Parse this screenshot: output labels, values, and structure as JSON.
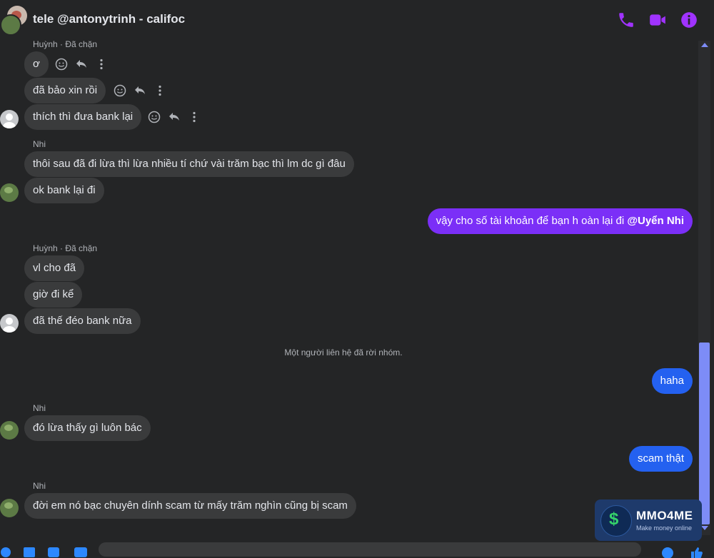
{
  "header": {
    "title": "tele @antonytrinh - califoc",
    "icons": [
      "phone-icon",
      "video-icon",
      "info-icon"
    ],
    "accent": "#a033ff"
  },
  "messages": {
    "s1": "Huỳnh · Đã chặn",
    "m1": "ơ",
    "m2": "đã bảo xin rồi",
    "m3": "thích thì đưa bank lại",
    "s2": "Nhi",
    "m4": "thôi sau đã đi lừa thì lừa nhiều tí chứ vài trăm bạc thì lm dc gì đâu",
    "m5": "ok bank lại đi",
    "m6_text": "vậy cho số tài khoản để bạn h oàn lại đi ",
    "m6_mention": "@Uyển Nhi",
    "s3": "Huỳnh · Đã chặn",
    "m7": "vl cho đã",
    "m8": "giờ đi kể",
    "m9": "đã thế đéo bank nữa",
    "system": "Một người liên hệ đã rời nhóm.",
    "m10": "haha",
    "s4": "Nhi",
    "m11": "đó lừa thấy gì luôn bác",
    "m12": "scam thật",
    "s5": "Nhi",
    "m13": "đời em nó bạc chuyên dính scam từ mấy trăm nghìn cũng bị scam"
  },
  "watermark": {
    "title": "MMO4ME",
    "subtitle": "Make money online"
  },
  "colors": {
    "background": "#242526",
    "incoming_bubble": "#3a3b3c",
    "outgoing_purple": "#7b2ff7",
    "outgoing_blue": "#2461f0"
  }
}
